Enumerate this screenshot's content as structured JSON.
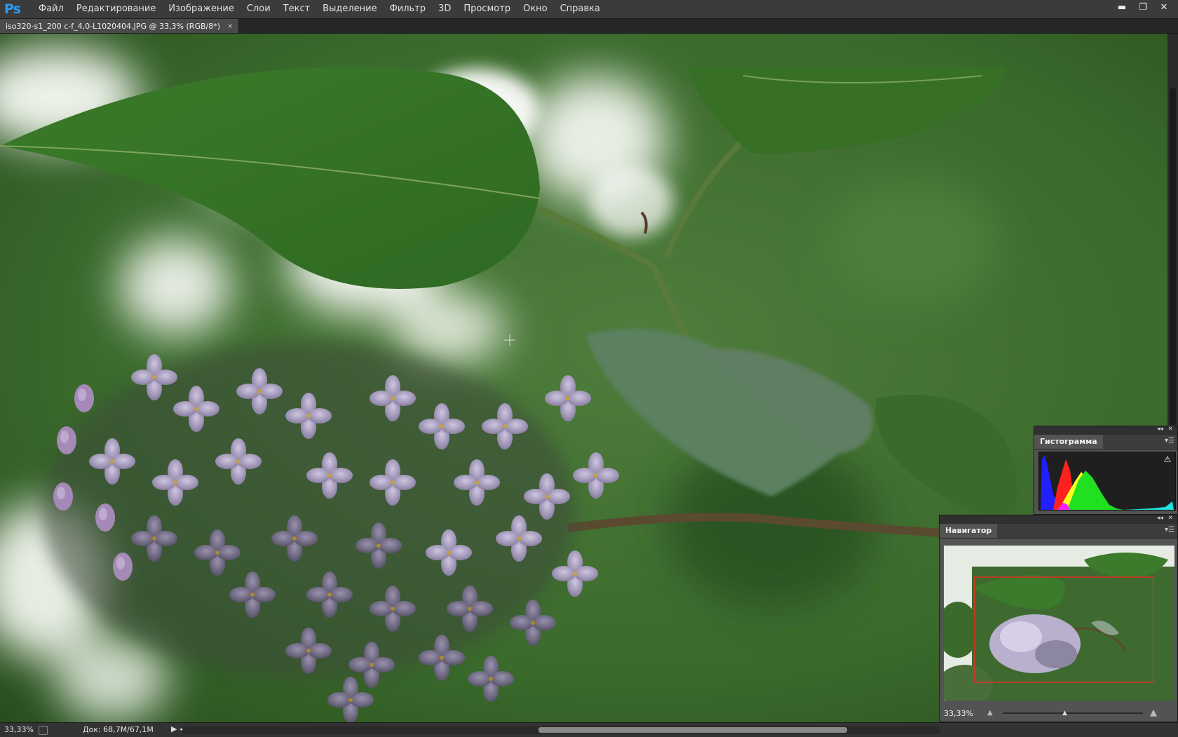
{
  "app": {
    "logo": "Ps"
  },
  "menu": [
    "Файл",
    "Редактирование",
    "Изображение",
    "Слои",
    "Текст",
    "Выделение",
    "Фильтр",
    "3D",
    "Просмотр",
    "Окно",
    "Справка"
  ],
  "window_controls": {
    "minimize": "▬",
    "restore": "❐",
    "close": "✕"
  },
  "document_tab": {
    "title": "iso320-s1_200 c-f_4,0-L1020404.JPG @ 33,3% (RGB/8*)",
    "close": "×"
  },
  "status": {
    "zoom": "33,33%",
    "doc_info": "Док: 68,7M/67,1M",
    "arrow": "▶ ◂"
  },
  "histogram_panel": {
    "title": "Гистограмма",
    "warning": "⚠",
    "collapse": "◂◂",
    "close": "✕",
    "menu": "▾☰"
  },
  "navigator_panel": {
    "title": "Навигатор",
    "zoom": "33,33%",
    "collapse": "◂◂",
    "close": "✕",
    "menu": "▾☰",
    "mountain_small": "▲",
    "mountain_large": "▲",
    "knob": "▲"
  },
  "colors": {
    "ps_blue": "#2d9bf0",
    "nav_frame": "#e03020"
  },
  "icons": [
    "ps-logo",
    "minimize-icon",
    "restore-icon",
    "close-icon",
    "tab-close-icon",
    "warning-icon",
    "collapse-icon",
    "panel-menu-icon",
    "mountain-icon"
  ]
}
